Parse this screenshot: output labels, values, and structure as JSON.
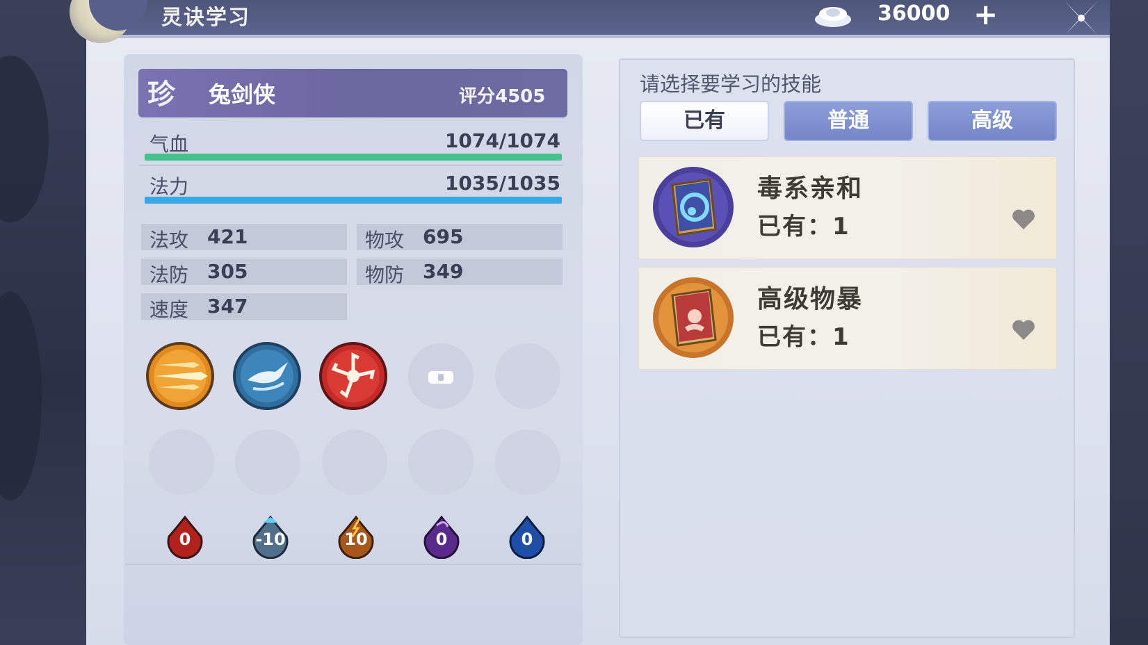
{
  "header": {
    "title": "灵诀学习",
    "currency_value": "36000",
    "add_label": "+"
  },
  "pet": {
    "rarity": "珍",
    "name": "兔剑侠",
    "score": "评分4505",
    "hp": {
      "label": "气血",
      "value": "1074/1074",
      "fraction": 1.0
    },
    "mp": {
      "label": "法力",
      "value": "1035/1035",
      "fraction": 1.0
    },
    "attributes": [
      {
        "label": "法攻",
        "value": "421"
      },
      {
        "label": "物攻",
        "value": "695"
      },
      {
        "label": "法防",
        "value": "305"
      },
      {
        "label": "物防",
        "value": "349"
      },
      {
        "label": "速度",
        "value": "347"
      }
    ],
    "elements": [
      {
        "value": "0",
        "color": "#b3211d"
      },
      {
        "value": "-10",
        "color": "#4f6f8a"
      },
      {
        "value": "10",
        "color": "#a8561a"
      },
      {
        "value": "0",
        "color": "#5a2a8a"
      },
      {
        "value": "0",
        "color": "#1e4ea8"
      }
    ]
  },
  "skills_panel": {
    "prompt": "请选择要学习的技能",
    "tabs": [
      {
        "label": "已有",
        "active": true
      },
      {
        "label": "普通",
        "active": false
      },
      {
        "label": "高级",
        "active": false
      }
    ],
    "items": [
      {
        "name": "毒系亲和",
        "owned": "已有：1",
        "book_color": "#4a3f9a",
        "icon": "poison-affinity-book-icon"
      },
      {
        "name": "高级物暴",
        "owned": "已有：1",
        "book_color": "#b83a3a",
        "icon": "advanced-physical-crit-book-icon"
      }
    ]
  }
}
